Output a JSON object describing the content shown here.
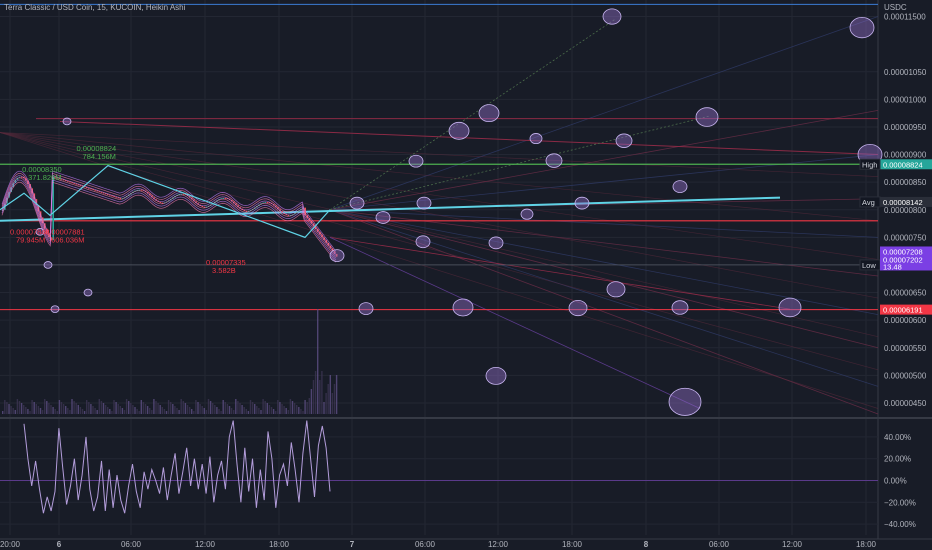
{
  "header": {
    "title": "Terra Classic / USD Coin, 15, KUCOIN, Heikin Ashi",
    "currency": "USDC"
  },
  "colors": {
    "background": "#181c27",
    "grid": "#232733",
    "bull": "#26a69a",
    "bear": "#ef5350",
    "cyan": "#5fd3e6",
    "purple_fill": "#8e6cc4",
    "green_line": "#4caf50",
    "red_line": "#f23645",
    "blue_line": "#3a7bd5",
    "oscillator": "#b39ddb"
  },
  "chart_data": {
    "type": "line",
    "price_axis": {
      "min": 4.3e-06,
      "max": 1.18e-05,
      "ticks": [
        "0.00011500",
        "0.00001050",
        "0.00001000",
        "0.00000950",
        "0.00000900",
        "0.00000850",
        "0.00000800",
        "0.00000750",
        "0.00000700",
        "0.00000650",
        "0.00000600",
        "0.00000550",
        "0.00000500",
        "0.00000450"
      ],
      "tick_values": [
        1.15e-05,
        1.05e-05,
        1e-05,
        9.5e-06,
        9e-06,
        8.5e-06,
        8e-06,
        7.5e-06,
        7e-06,
        6.5e-06,
        6e-06,
        5.5e-06,
        5e-06,
        4.5e-06
      ]
    },
    "time_axis": {
      "ticks": [
        "20:00",
        "6",
        "06:00",
        "12:00",
        "18:00",
        "7",
        "06:00",
        "12:00",
        "18:00",
        "8",
        "06:00",
        "12:00",
        "18:00"
      ],
      "bold": [
        "6",
        "7",
        "8"
      ]
    },
    "levels": {
      "high": {
        "label": "High",
        "value": "0.00008824",
        "num": 8.824e-06
      },
      "avg": {
        "label": "Avg",
        "value": "0.00008142",
        "num": 8.142e-06
      },
      "low": {
        "label": "Low",
        "value": "0.00007001",
        "num": 7.001e-06
      },
      "red_level": {
        "value": "0.00006191",
        "num": 6.191e-06
      },
      "cur1": {
        "value": "0.00007208",
        "num": 7.208e-06
      },
      "cur2": {
        "value": "0.00007202",
        "num": 7.202e-06
      },
      "cur3": {
        "value": "13.48"
      }
    },
    "annotations": [
      {
        "value": "0.00008824",
        "volume": "784.156M",
        "color": "green",
        "x": 5.5,
        "y": 9.06e-06
      },
      {
        "value": "0.00008350",
        "volume": "371.826M",
        "color": "green",
        "x": 1.0,
        "y": 8.68e-06
      },
      {
        "value": "0.00007848",
        "volume": "79.945M",
        "color": "red",
        "x": 0.0,
        "y": 7.55e-06
      },
      {
        "value": "0.00007881",
        "volume": "606.036M",
        "color": "red",
        "x": 2.9,
        "y": 7.55e-06
      },
      {
        "value": "0.00007335",
        "volume": "3.582B",
        "color": "red",
        "x": 16.2,
        "y": 7e-06
      }
    ],
    "oscillator": {
      "ticks": [
        "40.00%",
        "20.00%",
        "0.00%",
        "−20.00%",
        "−40.00%"
      ],
      "tick_values": [
        40,
        20,
        0,
        -20,
        -40
      ],
      "values": [
        52,
        20,
        -5,
        18,
        -8,
        -30,
        -15,
        -28,
        -10,
        48,
        12,
        -22,
        -5,
        20,
        -18,
        5,
        40,
        -8,
        -28,
        -15,
        18,
        -28,
        10,
        -25,
        5,
        -18,
        -30,
        -5,
        15,
        -10,
        -25,
        8,
        -8,
        10,
        0,
        -12,
        12,
        -18,
        5,
        25,
        -12,
        8,
        30,
        -5,
        20,
        -8,
        15,
        -12,
        22,
        -20,
        5,
        18,
        -8,
        40,
        55,
        15,
        -20,
        30,
        -10,
        20,
        -25,
        10,
        -18,
        45,
        20,
        -25,
        5,
        15,
        -5,
        35,
        10,
        -20,
        25,
        55,
        20,
        -15,
        32,
        50,
        30,
        -10
      ]
    }
  }
}
